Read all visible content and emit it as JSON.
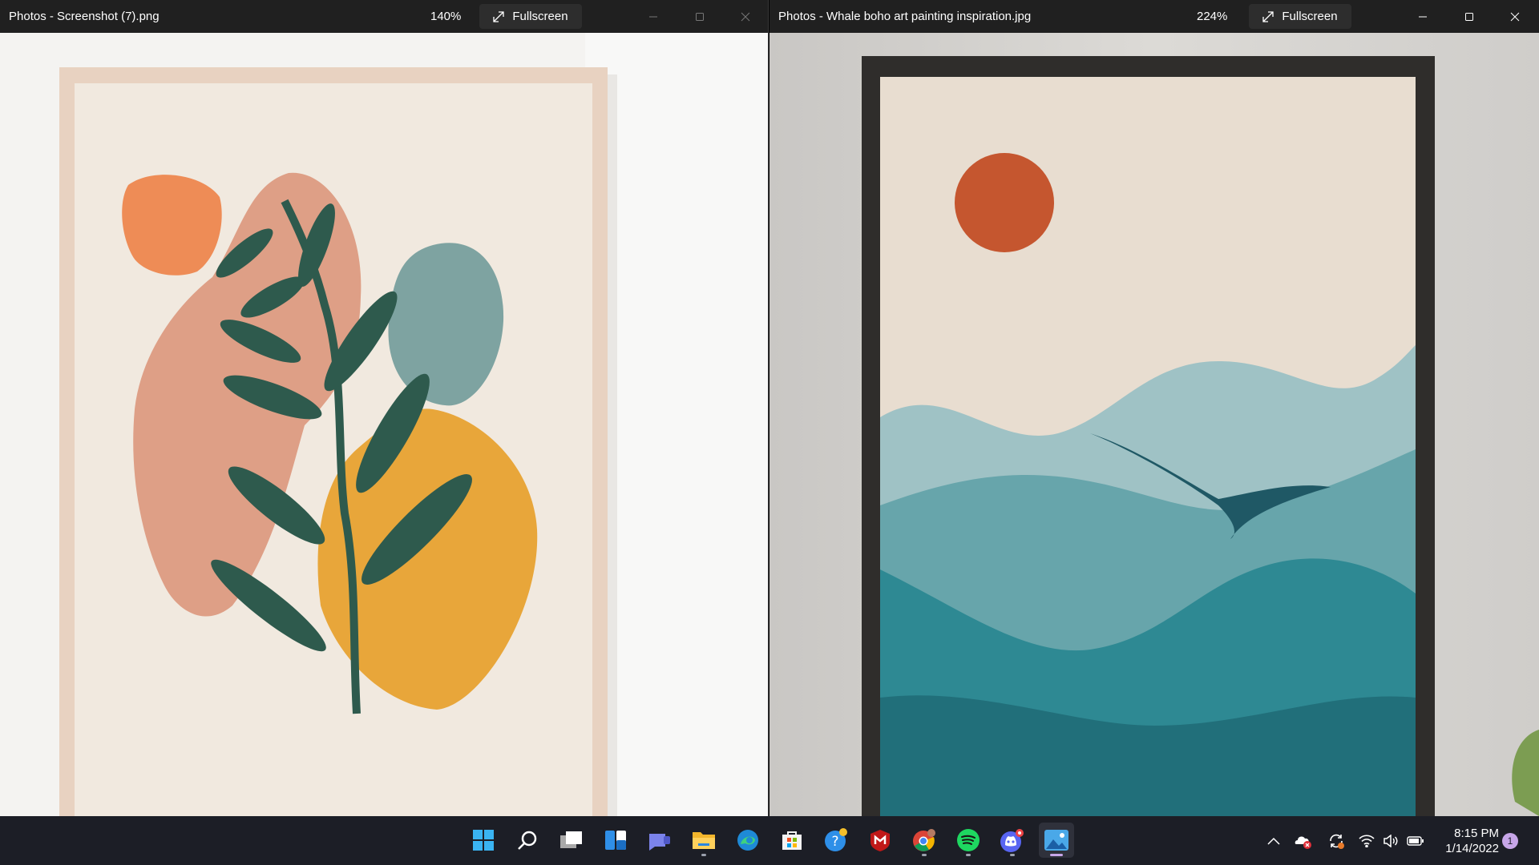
{
  "windows": {
    "left": {
      "title": "Photos - Screenshot (7).png",
      "zoom": "140%",
      "fullscreen_label": "Fullscreen",
      "image_description": "boho botanical wall art"
    },
    "right": {
      "title": "Photos - Whale boho art painting inspiration.jpg",
      "zoom": "224%",
      "fullscreen_label": "Fullscreen",
      "image_description": "whale boho wall art"
    }
  },
  "taskbar": {
    "apps": [
      {
        "name": "start-icon"
      },
      {
        "name": "search-icon"
      },
      {
        "name": "task-view-icon"
      },
      {
        "name": "widgets-icon"
      },
      {
        "name": "teams-chat-icon"
      },
      {
        "name": "file-explorer-icon"
      },
      {
        "name": "edge-icon"
      },
      {
        "name": "store-icon"
      },
      {
        "name": "help-icon"
      },
      {
        "name": "mcafee-icon"
      },
      {
        "name": "chrome-icon"
      },
      {
        "name": "spotify-icon"
      },
      {
        "name": "discord-icon"
      },
      {
        "name": "photos-icon"
      }
    ],
    "clock_time": "8:15 PM",
    "clock_date": "1/14/2022",
    "notification_count": "1"
  },
  "colors": {
    "titlebar": "#202020",
    "taskbar": "#1c1e26",
    "accent": "#c7a6e8"
  }
}
